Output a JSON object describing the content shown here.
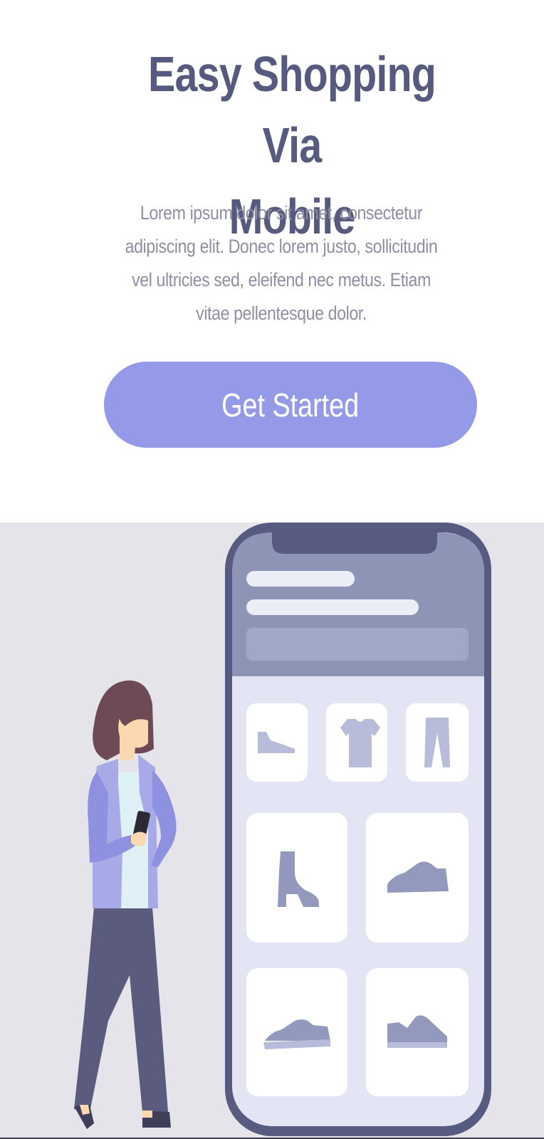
{
  "hero": {
    "title_line1": "Easy Shopping Via",
    "title_line2": "Mobile",
    "description_lines": [
      "Lorem ipsum dolor sit amet, consectetur",
      "adipiscing elit. Donec lorem justo, sollicitudin",
      "vel ultricies sed, eleifend nec metus. Etiam",
      "vitae pellentesque dolor."
    ],
    "cta_label": "Get Started"
  },
  "colors": {
    "title": "#565a7e",
    "description": "#8d8fa3",
    "accent": "#959ae8",
    "illustration_bg": "#e4e4ea",
    "phone_frame": "#585b80",
    "phone_header": "#8d94b6"
  },
  "illustration": {
    "phone_tiles": [
      "shoe-icon",
      "tshirt-icon",
      "pants-icon",
      "boot-icon",
      "sneaker-icon",
      "sneaker-icon",
      "sneaker-icon"
    ],
    "person": "woman-holding-phone"
  }
}
